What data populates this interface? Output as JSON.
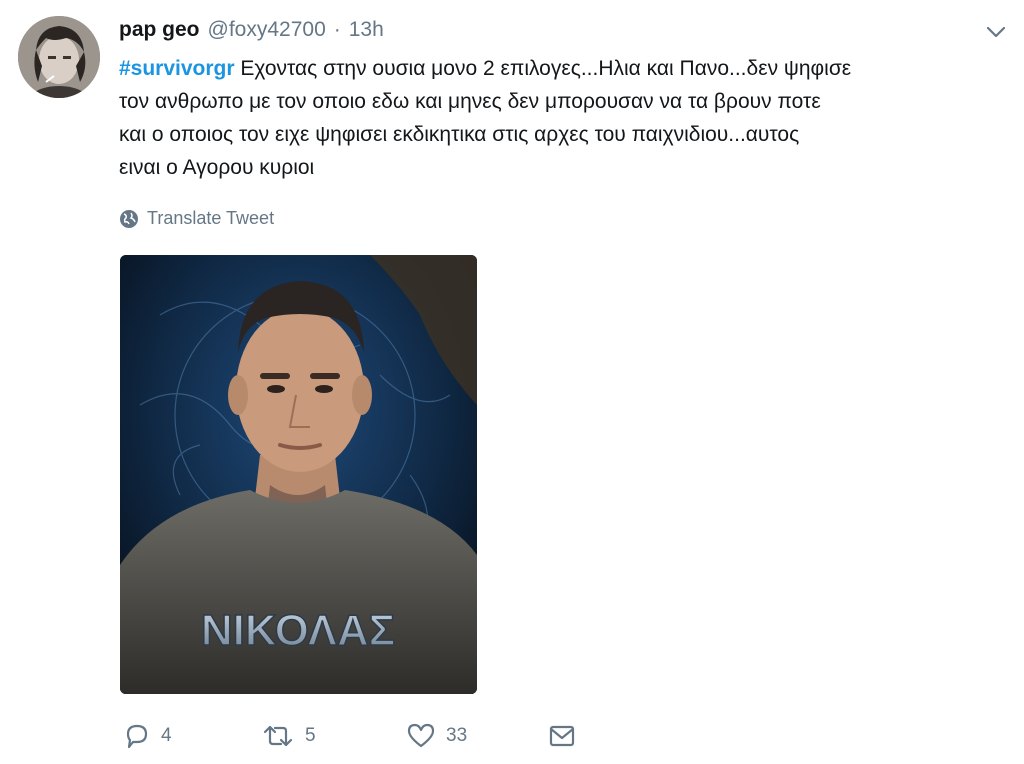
{
  "tweet": {
    "display_name": "pap geo",
    "handle": "@foxy42700",
    "separator": "·",
    "time": "13h",
    "hashtag": "#survivorgr",
    "text_line1": " Εχοντας στην ουσια μονο 2 επιλογες...Ηλια και Πανο...δεν ψηφισε",
    "text_line2": "τον ανθρωπο με τον οποιο εδω και μηνες δεν μπορουσαν να τα βρουν ποτε",
    "text_line3": "και ο οποιος  τον ειχε ψηφισει εκδικητικα στις αρχες του παιχνιδιου...αυτος",
    "text_line4": "ειναι ο Αγορου κυριοι",
    "translate_label": "Translate Tweet",
    "media_caption": "ΝΙΚΟΛΑΣ"
  },
  "actions": {
    "reply_count": "4",
    "retweet_count": "5",
    "like_count": "33"
  },
  "icons": {
    "avatar": "user-avatar",
    "caret": "chevron-down-icon",
    "translate": "globe-icon",
    "reply": "reply-icon",
    "retweet": "retweet-icon",
    "like": "heart-icon",
    "message": "envelope-icon"
  },
  "colors": {
    "text": "#14171a",
    "secondary": "#657786",
    "link": "#1b95e0",
    "background": "#ffffff"
  }
}
